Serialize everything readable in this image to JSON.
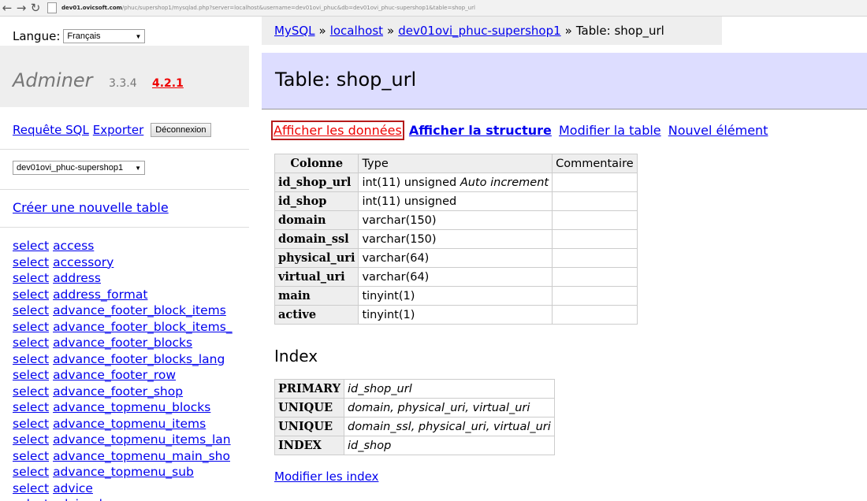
{
  "browser": {
    "url_host": "dev01.ovicsoft.com",
    "url_rest": "/phuc/supershop1/mysqlad.php?server=localhost&username=dev01ovi_phuc&db=dev01ovi_phuc-supershop1&table=shop_url"
  },
  "sidebar": {
    "lang_label": "Langue:",
    "lang_value": "Français",
    "brand": "Adminer",
    "version": "3.3.4",
    "new_version": "4.2.1",
    "sql_link": "Requête SQL",
    "export_link": "Exporter",
    "logout_button": "Déconnexion",
    "db_value": "dev01ovi_phuc-supershop1",
    "create_table": "Créer une nouvelle table",
    "select_label": "select",
    "tables": [
      "access",
      "accessory",
      "address",
      "address_format",
      "advance_footer_block_items",
      "advance_footer_block_items_",
      "advance_footer_blocks",
      "advance_footer_blocks_lang",
      "advance_footer_row",
      "advance_footer_shop",
      "advance_topmenu_blocks",
      "advance_topmenu_items",
      "advance_topmenu_items_lan",
      "advance_topmenu_main_sho",
      "advance_topmenu_sub",
      "advice",
      "advice_lang"
    ]
  },
  "breadcrumb": {
    "mysql": "MySQL",
    "sep": "»",
    "server": "localhost",
    "db": "dev01ovi_phuc-supershop1",
    "current": "Table: shop_url"
  },
  "main": {
    "title": "Table: shop_url",
    "links": {
      "data": "Afficher les données",
      "structure": "Afficher la structure",
      "alter": "Modifier la table",
      "new_item": "Nouvel élément"
    },
    "columns_header": [
      "Colonne",
      "Type",
      "Commentaire"
    ],
    "columns": [
      {
        "name": "id_shop_url",
        "type": "int(11) unsigned",
        "extra": "Auto increment"
      },
      {
        "name": "id_shop",
        "type": "int(11) unsigned",
        "extra": ""
      },
      {
        "name": "domain",
        "type": "varchar(150)",
        "extra": ""
      },
      {
        "name": "domain_ssl",
        "type": "varchar(150)",
        "extra": ""
      },
      {
        "name": "physical_uri",
        "type": "varchar(64)",
        "extra": ""
      },
      {
        "name": "virtual_uri",
        "type": "varchar(64)",
        "extra": ""
      },
      {
        "name": "main",
        "type": "tinyint(1)",
        "extra": ""
      },
      {
        "name": "active",
        "type": "tinyint(1)",
        "extra": ""
      }
    ],
    "index_heading": "Index",
    "indexes": [
      {
        "kind": "PRIMARY",
        "cols": "id_shop_url"
      },
      {
        "kind": "UNIQUE",
        "cols": "domain, physical_uri, virtual_uri"
      },
      {
        "kind": "UNIQUE",
        "cols": "domain_ssl, physical_uri, virtual_uri"
      },
      {
        "kind": "INDEX",
        "cols": "id_shop"
      }
    ],
    "edit_index": "Modifier les index"
  }
}
